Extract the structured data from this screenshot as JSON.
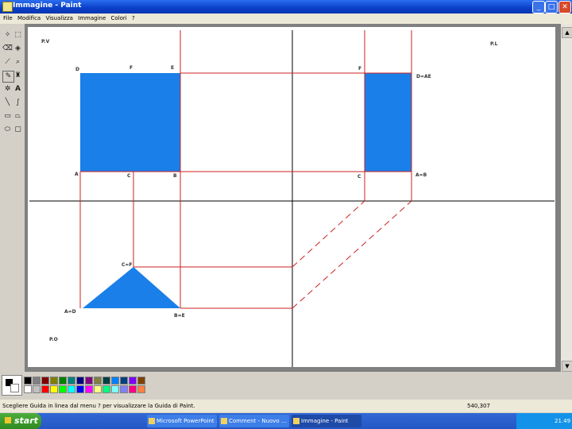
{
  "window": {
    "title": "Immagine - Paint"
  },
  "menu": {
    "items": [
      "File",
      "Modifica",
      "Visualizza",
      "Immagine",
      "Colori",
      "?"
    ]
  },
  "drawing": {
    "labels": {
      "pv": "P.V",
      "pl": "P.L",
      "po": "P.O",
      "d": "D",
      "f": "F",
      "e": "E",
      "a": "A",
      "c": "C",
      "b": "B",
      "f_pl": "F",
      "de": "D=AE",
      "c_pl": "C",
      "ab": "A=B",
      "cf": "C=F",
      "ad": "A=D",
      "be": "B=E"
    }
  },
  "status": {
    "hint": "Scegliere Guida in linea dal menu ? per visualizzare la Guida di Paint.",
    "coords": "540,307"
  },
  "taskbar": {
    "start": "start",
    "tasks": [
      "Microsoft PowerPoint ...",
      "Comment - Nuovo ...",
      "Immagine - Paint"
    ],
    "clock": "21.49"
  },
  "colors": {
    "accent_fill": "#1a7fe8",
    "line": "#cc2222"
  }
}
